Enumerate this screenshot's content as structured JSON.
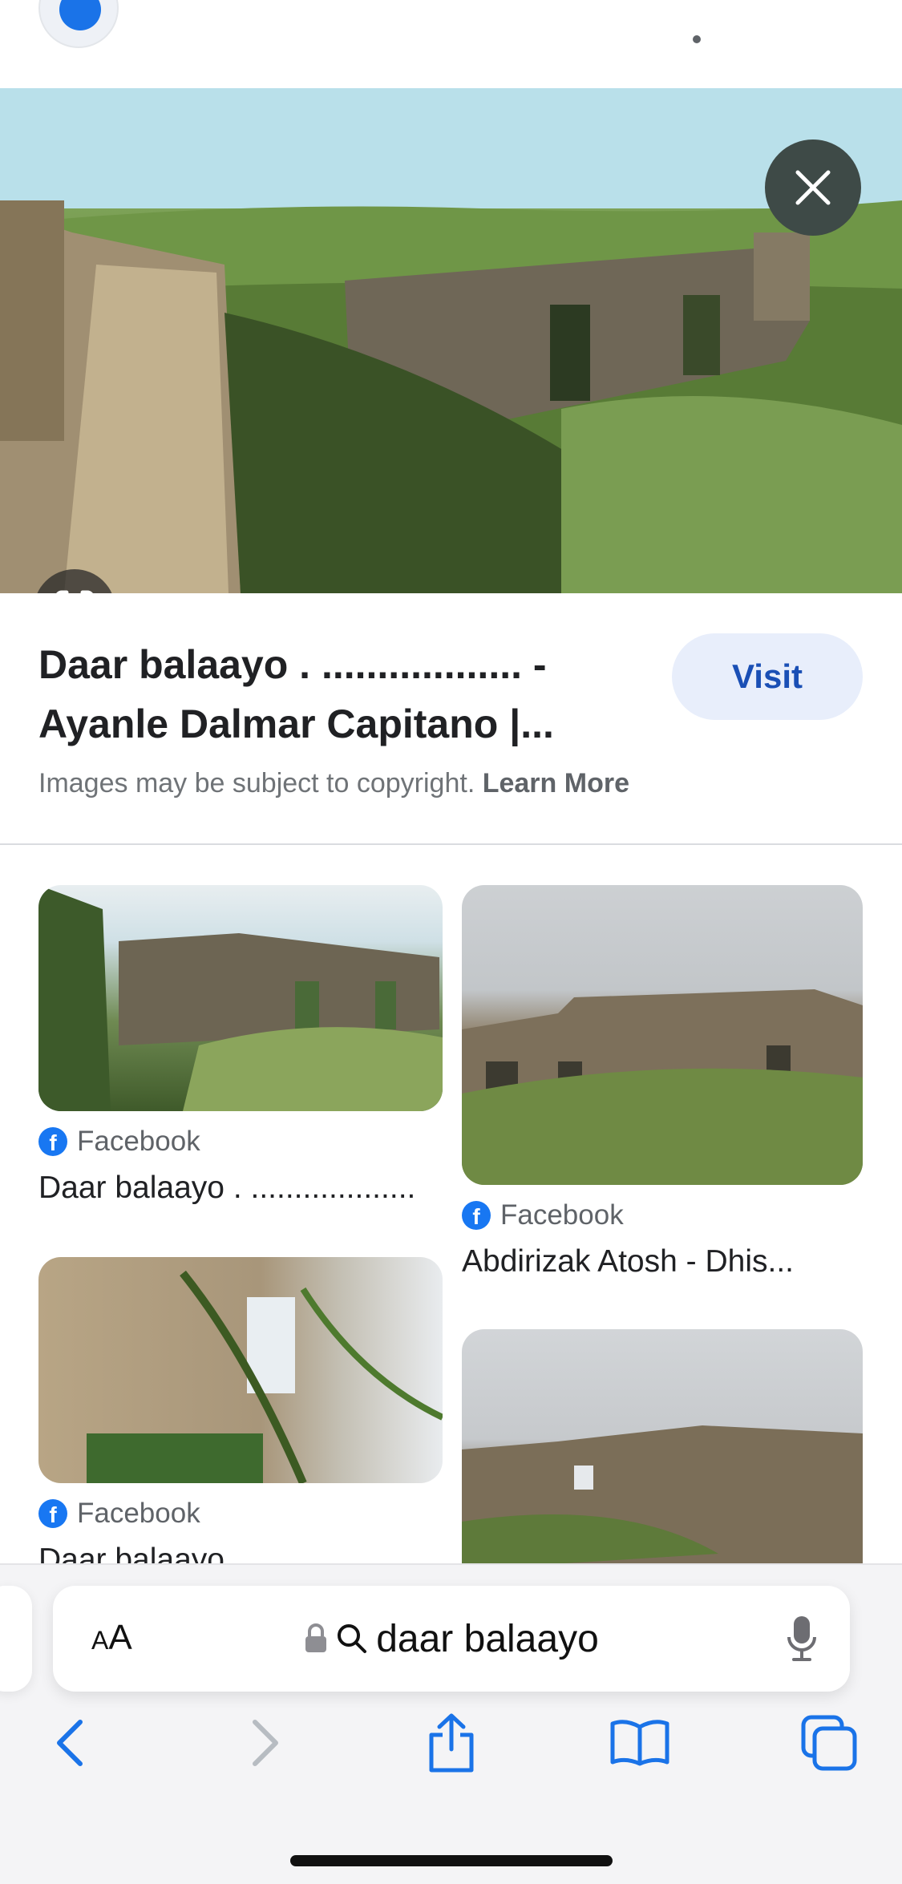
{
  "hero": {
    "close_icon": "close-icon",
    "lens_icon": "google-lens-icon"
  },
  "result": {
    "title": "Daar balaayo . .................. - Ayanle Dalmar Capitano |...",
    "visit_label": "Visit",
    "copyright_text": "Images may be subject to copyright.",
    "learn_more_label": "Learn More"
  },
  "related": [
    {
      "source": "Facebook",
      "caption": "Daar balaayo . ..................."
    },
    {
      "source": "Facebook",
      "caption": "Abdirizak Atosh - Dhis..."
    },
    {
      "source": "Facebook",
      "caption": "Daar balaayo"
    }
  ],
  "browser": {
    "text_size_label_small": "A",
    "text_size_label_large": "A",
    "url_text": "daar balaayo",
    "icons": [
      "back-icon",
      "forward-icon",
      "share-icon",
      "bookmarks-icon",
      "tabs-icon",
      "lock-icon",
      "search-icon",
      "microphone-icon"
    ],
    "accent": "#1a73e8"
  }
}
